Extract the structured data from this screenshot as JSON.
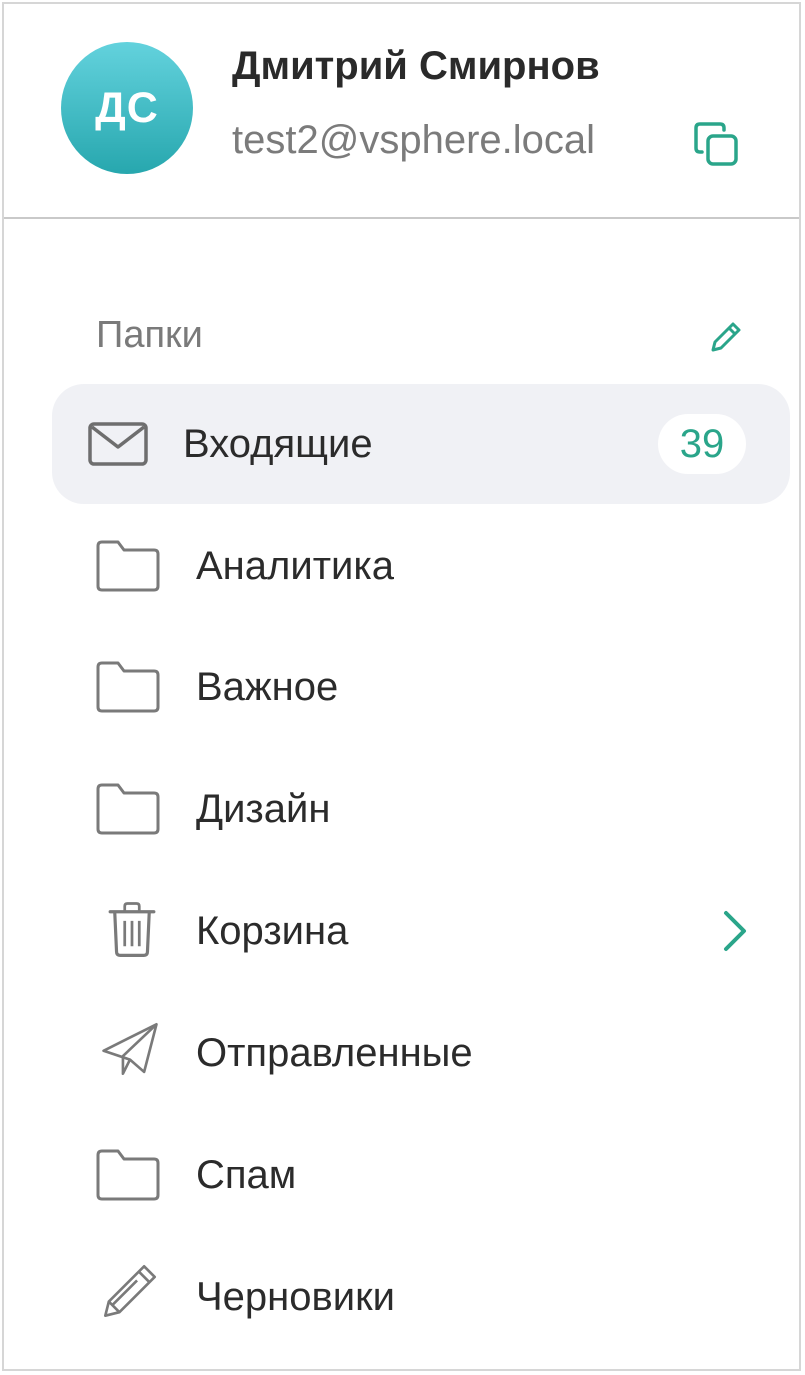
{
  "profile": {
    "initials": "ДС",
    "name": "Дмитрий Смирнов",
    "email": "test2@vsphere.local",
    "copy_icon": "copy-icon"
  },
  "folders_section": {
    "title": "Папки",
    "edit_icon": "pencil-icon"
  },
  "folders": [
    {
      "label": "Входящие",
      "icon": "envelope-icon",
      "badge": "39",
      "active": true
    },
    {
      "label": "Аналитика",
      "icon": "folder-icon"
    },
    {
      "label": "Важное",
      "icon": "folder-icon"
    },
    {
      "label": "Дизайн",
      "icon": "folder-icon"
    },
    {
      "label": "Корзина",
      "icon": "trash-icon",
      "has_children": true
    },
    {
      "label": "Отправленные",
      "icon": "paper-plane-icon"
    },
    {
      "label": "Спам",
      "icon": "folder-icon"
    },
    {
      "label": "Черновики",
      "icon": "pencil-icon"
    }
  ],
  "colors": {
    "accent": "#2aa58a",
    "avatar_top": "#63d2dd",
    "avatar_bottom": "#27a7ae",
    "active_row": "#f0f1f5"
  }
}
